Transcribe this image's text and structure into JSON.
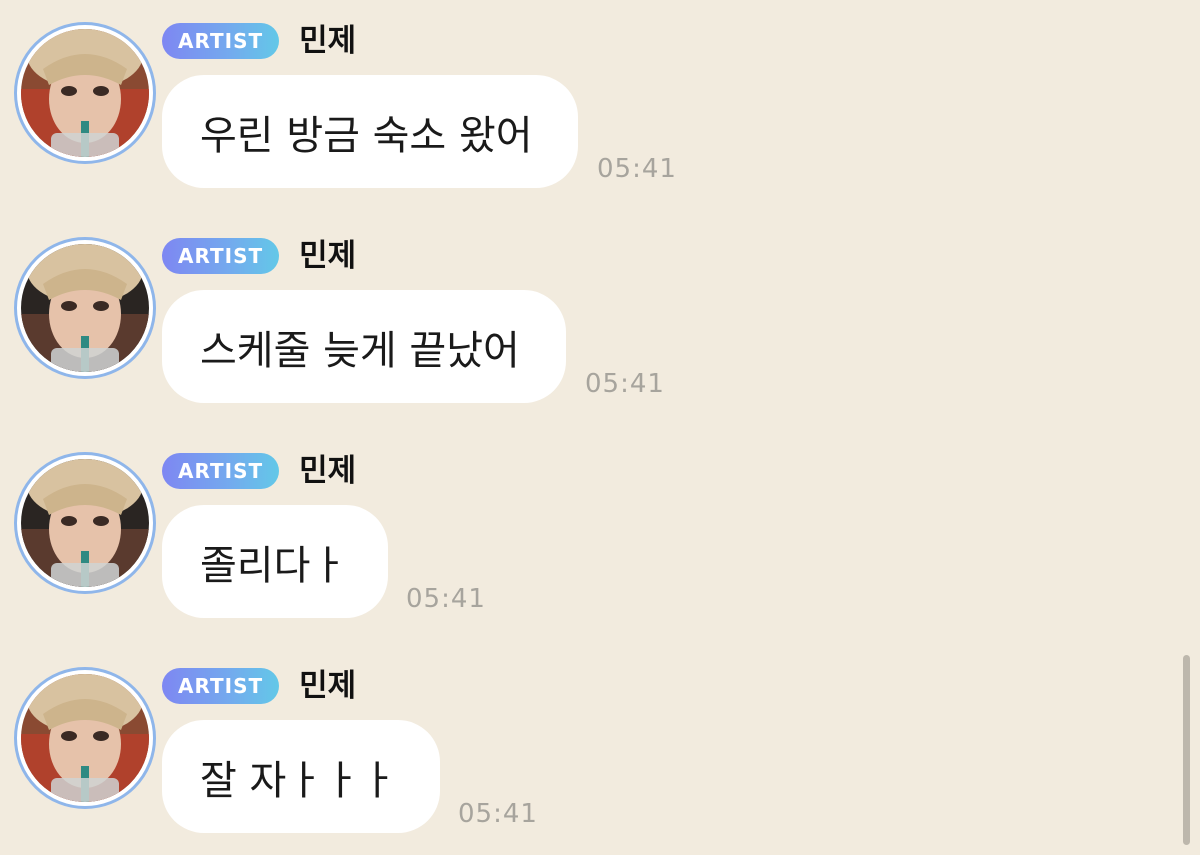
{
  "messages": [
    {
      "badge": "ARTIST",
      "name": "민제",
      "text": "우린 방금 숙소 왔어",
      "time": "05:41"
    },
    {
      "badge": "ARTIST",
      "name": "민제",
      "text": "스케줄 늦게 끝났어",
      "time": "05:41"
    },
    {
      "badge": "ARTIST",
      "name": "민제",
      "text": "졸리다ㅏ",
      "time": "05:41"
    },
    {
      "badge": "ARTIST",
      "name": "민제",
      "text": "잘 자ㅏㅏㅏ",
      "time": "05:41"
    }
  ],
  "colors": {
    "background": "#f2ebde",
    "bubble": "#ffffff",
    "avatar_ring": "#8fb6ea",
    "badge_gradient_start": "#7e87f2",
    "badge_gradient_end": "#63c8e8",
    "timestamp": "#a7a49d"
  },
  "icons": {
    "avatar": "avatar-photo"
  }
}
